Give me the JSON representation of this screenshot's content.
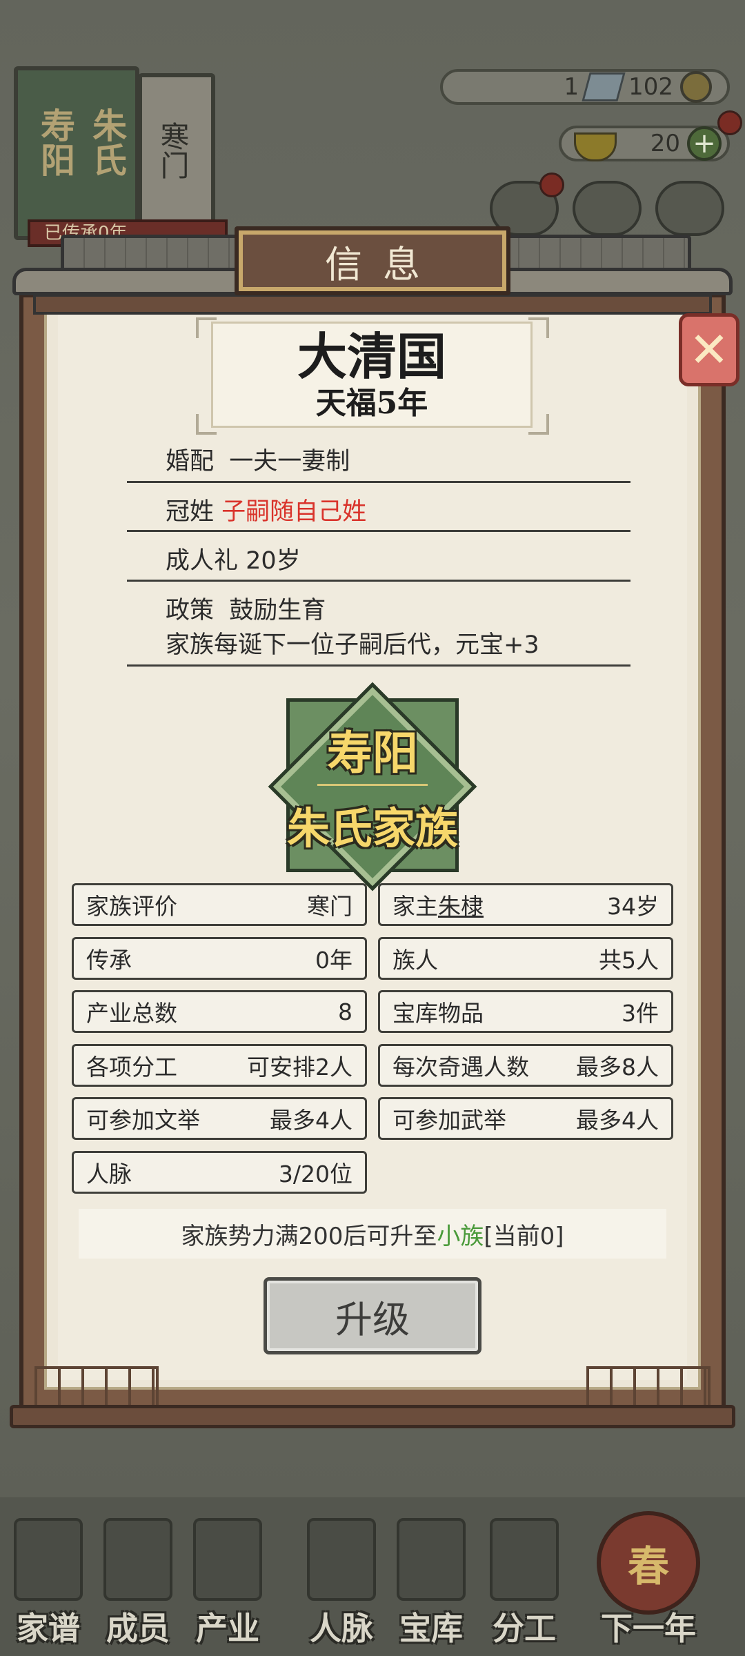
{
  "background": {
    "top_left_book": {
      "line1": "寿阳",
      "line2": "朱氏",
      "class_label": "寒门",
      "ribbon_text": "已传承0年"
    },
    "currency": {
      "silver": "1",
      "copper": "102",
      "gold": "20"
    },
    "bottom_nav": [
      {
        "label": "家谱",
        "icon": "genealogy-book-icon"
      },
      {
        "label": "成员",
        "icon": "member-portrait-icon"
      },
      {
        "label": "产业",
        "icon": "building-icon"
      },
      {
        "label": "人脉",
        "icon": "network-icon"
      },
      {
        "label": "宝库",
        "icon": "treasure-chest-icon"
      },
      {
        "label": "分工",
        "icon": "scroll-icon"
      },
      {
        "label": "下一年",
        "icon": "lantern-icon",
        "badge": "春"
      }
    ]
  },
  "dialog": {
    "title": "信息",
    "state": {
      "name": "大清国",
      "era": "天福5年"
    },
    "policies": {
      "marriage_label": "婚配",
      "marriage_value": "一夫一妻制",
      "surname_label": "冠姓",
      "surname_value": "子嗣随自己姓",
      "adult_label": "成人礼",
      "adult_value": "20岁",
      "policy_label": "政策",
      "policy_value": "鼓励生育",
      "policy_desc": "家族每诞下一位子嗣后代，元宝+3"
    },
    "emblem": {
      "line1": "寿阳",
      "line2": "朱氏家族"
    },
    "stats": {
      "rating_label": "家族评价",
      "rating_value": "寒门",
      "head_prefix": "家主",
      "head_name": "朱棣",
      "head_age": "34岁",
      "inherit_label": "传承",
      "inherit_value": "0年",
      "members_label": "族人",
      "members_value": "共5人",
      "industry_label": "产业总数",
      "industry_value": "8",
      "treasury_label": "宝库物品",
      "treasury_value": "3件",
      "division_label": "各项分工",
      "division_value": "可安排2人",
      "encounter_label": "每次奇遇人数",
      "encounter_value": "最多8人",
      "civil_label": "可参加文举",
      "civil_value": "最多4人",
      "military_label": "可参加武举",
      "military_value": "最多4人",
      "network_label": "人脉",
      "network_value": "3/20位"
    },
    "notice": {
      "prefix": "家族势力满200后可升至",
      "target": "小族",
      "suffix": "[当前0]"
    },
    "upgrade_button": "升级"
  },
  "colors": {
    "accent_red": "#d9332b",
    "accent_green": "#4a9a3a",
    "emblem_gold": "#f6d76b"
  }
}
